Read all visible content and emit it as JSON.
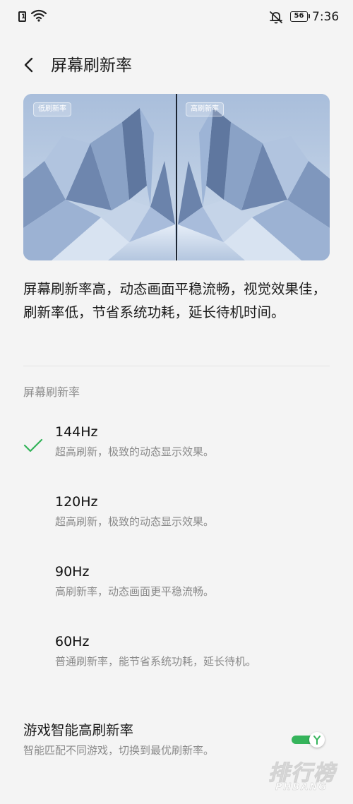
{
  "status_bar": {
    "sim_label": "1",
    "battery": "56",
    "time": "7:36"
  },
  "header": {
    "title": "屏幕刷新率"
  },
  "preview": {
    "left_tag": "低刷新率",
    "right_tag": "高刷新率"
  },
  "description": "屏幕刷新率高，动态画面平稳流畅，视觉效果佳，刷新率低，节省系统功耗，延长待机时间。",
  "section_title": "屏幕刷新率",
  "options": [
    {
      "rate": "144Hz",
      "desc": "超高刷新，极致的动态显示效果。",
      "selected": true
    },
    {
      "rate": "120Hz",
      "desc": "超高刷新，极致的动态显示效果。",
      "selected": false
    },
    {
      "rate": "90Hz",
      "desc": "高刷新率，动态画面更平稳流畅。",
      "selected": false
    },
    {
      "rate": "60Hz",
      "desc": "普通刷新率，能节省系统功耗，延长待机。",
      "selected": false
    }
  ],
  "game": {
    "title": "游戏智能高刷新率",
    "desc": "智能匹配不同游戏，切换到最优刷新率。",
    "enabled": true
  },
  "colors": {
    "accent": "#35b45b",
    "background": "#f4f4f4",
    "secondary_text": "#8a8a8a"
  },
  "watermark": {
    "main": "排行榜",
    "sub": "PHBANG"
  }
}
